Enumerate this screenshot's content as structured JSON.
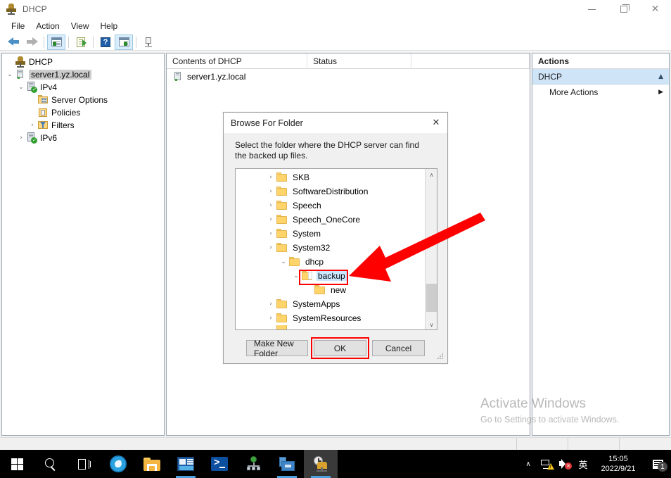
{
  "window": {
    "title": "DHCP",
    "icon": "dhcp-icon",
    "controls": {
      "minimize": "—",
      "maximize": "❐",
      "close": "✕"
    }
  },
  "menu": {
    "items": [
      "File",
      "Action",
      "View",
      "Help"
    ]
  },
  "toolbar": {
    "items": [
      {
        "name": "back-arrow-icon",
        "label": "Back"
      },
      {
        "name": "forward-arrow-icon",
        "label": "Forward"
      },
      {
        "name": "show-tree-icon",
        "label": "Show/Hide Console Tree"
      },
      {
        "name": "export-list-icon",
        "label": "Export List"
      },
      {
        "name": "help-icon",
        "label": "Help"
      },
      {
        "name": "show-action-pane-icon",
        "label": "Show/Hide Action Pane"
      },
      {
        "name": "refresh-server-icon",
        "label": "Server"
      }
    ]
  },
  "tree": {
    "nodes": [
      {
        "label": "DHCP",
        "icon": "dhcp-root-icon",
        "indent": 1,
        "expander": "",
        "selected": false
      },
      {
        "label": "server1.yz.local",
        "icon": "server-icon",
        "indent": 2,
        "expander": "⌄",
        "selected": true
      },
      {
        "label": "IPv4",
        "icon": "ipv4-icon",
        "indent": 3,
        "expander": "⌄",
        "selected": false
      },
      {
        "label": "Server Options",
        "icon": "server-options-icon",
        "indent": 4,
        "expander": "",
        "selected": false
      },
      {
        "label": "Policies",
        "icon": "policies-icon",
        "indent": 4,
        "expander": "",
        "selected": false
      },
      {
        "label": "Filters",
        "icon": "filters-icon",
        "indent": 4,
        "expander": "›",
        "selected": false
      },
      {
        "label": "IPv6",
        "icon": "ipv6-icon",
        "indent": 3,
        "expander": "›",
        "selected": false
      }
    ]
  },
  "list": {
    "columns": [
      "Contents of DHCP",
      "Status",
      ""
    ],
    "rows": [
      {
        "name": "server1.yz.local",
        "status": "",
        "icon": "server-icon"
      }
    ]
  },
  "actions": {
    "header": "Actions",
    "group": {
      "label": "DHCP",
      "caret": "▲"
    },
    "items": [
      {
        "label": "More Actions",
        "caret": "▶"
      }
    ]
  },
  "watermark": {
    "line1": "Activate Windows",
    "line2": "Go to Settings to activate Windows."
  },
  "dialog": {
    "title": "Browse For Folder",
    "close": "✕",
    "message": "Select the folder where the DHCP server can find the backed up files.",
    "folders": [
      {
        "label": "SKB",
        "indent": 1,
        "expander": "›",
        "highlight": false,
        "child": false
      },
      {
        "label": "SoftwareDistribution",
        "indent": 1,
        "expander": "›",
        "highlight": false,
        "child": false
      },
      {
        "label": "Speech",
        "indent": 1,
        "expander": "›",
        "highlight": false,
        "child": false
      },
      {
        "label": "Speech_OneCore",
        "indent": 1,
        "expander": "›",
        "highlight": false,
        "child": false
      },
      {
        "label": "System",
        "indent": 1,
        "expander": "›",
        "highlight": false,
        "child": false
      },
      {
        "label": "System32",
        "indent": 1,
        "expander": "›",
        "highlight": false,
        "child": false
      },
      {
        "label": "dhcp",
        "indent": 2,
        "expander": "⌄",
        "highlight": false,
        "child": false
      },
      {
        "label": "backup",
        "indent": 3,
        "expander": "⌄",
        "highlight": true,
        "child": false
      },
      {
        "label": "new",
        "indent": 4,
        "expander": "",
        "highlight": false,
        "child": true
      },
      {
        "label": "SystemApps",
        "indent": 1,
        "expander": "›",
        "highlight": false,
        "child": false
      },
      {
        "label": "SystemResources",
        "indent": 1,
        "expander": "›",
        "highlight": false,
        "child": false
      }
    ],
    "scroll": {
      "up": "∧",
      "down": "∨"
    },
    "buttons": {
      "make_new_folder": "Make New Folder",
      "ok": "OK",
      "cancel": "Cancel"
    }
  },
  "annotation": {
    "arrow_color": "#fe0000",
    "highlight_color": "#ff0000"
  },
  "taskbar": {
    "items": [
      {
        "name": "start-button",
        "label": "Start"
      },
      {
        "name": "search-icon",
        "label": "Search"
      },
      {
        "name": "task-view-icon",
        "label": "Task View"
      },
      {
        "name": "internet-explorer-icon",
        "label": "Internet Explorer"
      },
      {
        "name": "file-explorer-icon",
        "label": "File Explorer"
      },
      {
        "name": "server-manager-tile-icon",
        "label": "Server Manager"
      },
      {
        "name": "powershell-icon",
        "label": "Windows PowerShell"
      },
      {
        "name": "network-tool-icon",
        "label": "Network"
      },
      {
        "name": "server-manager-icon",
        "label": "Server Manager"
      },
      {
        "name": "dhcp-taskbar-icon",
        "label": "DHCP"
      }
    ],
    "tray": {
      "overflow": "∧",
      "network_icon": "network-warning-icon",
      "volume_icon": "volume-muted-icon",
      "ime": "英",
      "time": "15:05",
      "date": "2022/9/21",
      "notification_count": "1"
    }
  }
}
